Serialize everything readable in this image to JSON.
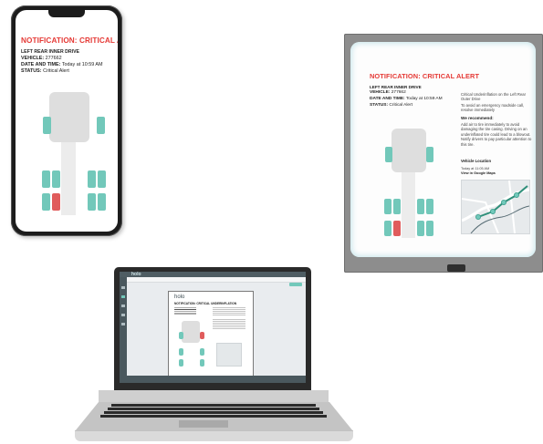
{
  "notification": {
    "title": "NOTIFICATION: CRITICAL ALERT",
    "location": "LEFT REAR INNER DRIVE",
    "vehicle_label": "VEHICLE:",
    "vehicle_value": "277662",
    "date_label": "DATE AND TIME:",
    "date_value": "Today at 10:59 AM",
    "status_label": "STATUS:",
    "status_value": "Critical Alert"
  },
  "wall_display": {
    "description": "Critical Underinflation on the Left Rear Outer Drive",
    "instruction": "To avoid an emergency roadside call, resolve immediately",
    "recommend_heading": "We recommend:",
    "recommend_body": "Add air to tire immediately to avoid damaging the tire casing. Driving on an underinflated tire could lead to a blowout. Notify drivers to pay particular attention to this tire.",
    "vehicle_location_label": "Vehicle Location",
    "location_time": "Today at 11:05 AM",
    "map_link": "View in Google Maps"
  },
  "laptop": {
    "app_logo": "holo",
    "doc_logo": "holo",
    "doc_title": "NOTIFICATION: CRITICAL UNDERINFLATION"
  },
  "colors": {
    "alert_red": "#e53935",
    "tire_ok": "#72c8ba",
    "tire_alert": "#e05c5c",
    "app_header": "#4f5d63"
  }
}
